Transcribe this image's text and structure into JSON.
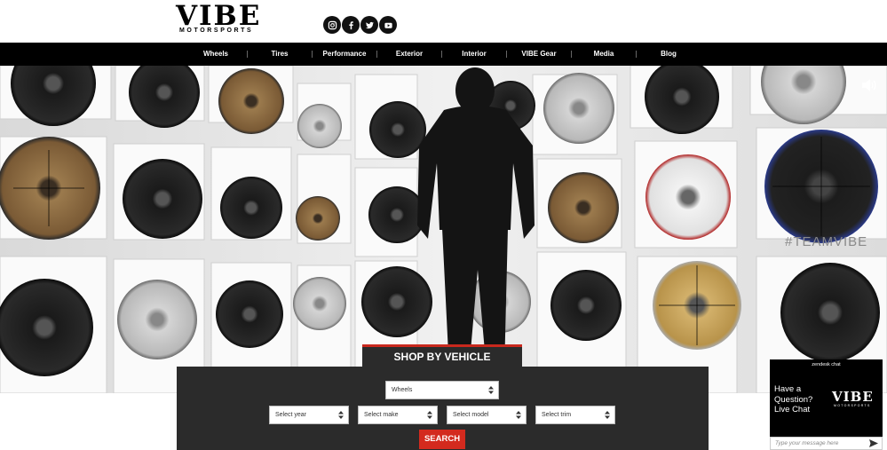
{
  "brand": {
    "logo_main": "VIBE",
    "logo_sub": "MOTORSPORTS"
  },
  "social": [
    {
      "icon": "instagram-icon"
    },
    {
      "icon": "facebook-icon"
    },
    {
      "icon": "twitter-icon"
    },
    {
      "icon": "youtube-icon"
    }
  ],
  "nav": {
    "items": [
      {
        "label": "Wheels"
      },
      {
        "label": "Tires"
      },
      {
        "label": "Performance"
      },
      {
        "label": "Exterior"
      },
      {
        "label": "Interior"
      },
      {
        "label": "VIBE Gear"
      },
      {
        "label": "Media"
      },
      {
        "label": "Blog"
      }
    ]
  },
  "hero": {
    "hashtag": "#TEAMVIBE",
    "sound_icon": "volume-icon"
  },
  "shop_by_vehicle": {
    "title": "SHOP BY VEHICLE",
    "category": "Wheels",
    "year": "Select year",
    "make": "Select make",
    "model": "Select model",
    "trim": "Select trim",
    "search_label": "SEARCH"
  },
  "chat": {
    "brand": "zendesk chat",
    "question": "Have a Question? Live Chat",
    "logo_main": "VIBE",
    "logo_sub": "MOTORSPORTS",
    "input_placeholder": "Type your message here"
  },
  "colors": {
    "nav_bg": "#000000",
    "accent": "#d32a1e",
    "panel_bg": "#2b2b2b"
  }
}
